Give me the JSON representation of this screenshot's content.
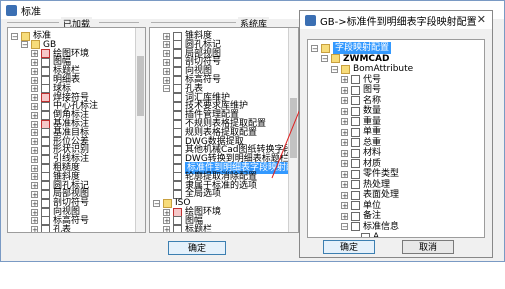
{
  "main_window": {
    "title": "标准",
    "loaded_label": "已加载",
    "system_label": "系统库",
    "ok_label": "确定"
  },
  "left_tree": [
    {
      "label": "标准",
      "indent": 0,
      "exp": "-",
      "icon": "folder"
    },
    {
      "label": "GB",
      "indent": 1,
      "exp": "-",
      "icon": "folder"
    },
    {
      "label": "绘图环境",
      "indent": 2,
      "exp": "+",
      "icon": "red"
    },
    {
      "label": "图幅",
      "indent": 2,
      "exp": "+",
      "icon": "doc"
    },
    {
      "label": "标题栏",
      "indent": 2,
      "exp": "+",
      "icon": "doc"
    },
    {
      "label": "明细表",
      "indent": 2,
      "exp": "+",
      "icon": "doc"
    },
    {
      "label": "球标",
      "indent": 2,
      "exp": "+",
      "icon": "doc"
    },
    {
      "label": "焊接符号",
      "indent": 2,
      "exp": "+",
      "icon": "red"
    },
    {
      "label": "中心孔标注",
      "indent": 2,
      "exp": "+",
      "icon": "doc"
    },
    {
      "label": "倒角标注",
      "indent": 2,
      "exp": "+",
      "icon": "doc"
    },
    {
      "label": "基准标注",
      "indent": 2,
      "exp": "+",
      "icon": "red"
    },
    {
      "label": "基准目标",
      "indent": 2,
      "exp": "+",
      "icon": "doc"
    },
    {
      "label": "形位公差",
      "indent": 2,
      "exp": "+",
      "icon": "doc"
    },
    {
      "label": "形状识别",
      "indent": 2,
      "exp": "+",
      "icon": "doc"
    },
    {
      "label": "引线标注",
      "indent": 2,
      "exp": "+",
      "icon": "doc"
    },
    {
      "label": "粗糙度",
      "indent": 2,
      "exp": "+",
      "icon": "doc"
    },
    {
      "label": "锥斜度",
      "indent": 2,
      "exp": "+",
      "icon": "doc"
    },
    {
      "label": "圆孔标记",
      "indent": 2,
      "exp": "+",
      "icon": "doc"
    },
    {
      "label": "局部视图",
      "indent": 2,
      "exp": "+",
      "icon": "doc"
    },
    {
      "label": "剖切符号",
      "indent": 2,
      "exp": "+",
      "icon": "doc"
    },
    {
      "label": "向视图",
      "indent": 2,
      "exp": "+",
      "icon": "doc"
    },
    {
      "label": "标高符号",
      "indent": 2,
      "exp": "+",
      "icon": "doc"
    },
    {
      "label": "孔表",
      "indent": 2,
      "exp": "+",
      "icon": "doc"
    }
  ],
  "middle_tree": [
    {
      "label": "锥斜度",
      "indent": 1,
      "exp": "+",
      "icon": "doc"
    },
    {
      "label": "圆孔标记",
      "indent": 1,
      "exp": "+",
      "icon": "doc"
    },
    {
      "label": "局部视图",
      "indent": 1,
      "exp": "+",
      "icon": "doc"
    },
    {
      "label": "剖切符号",
      "indent": 1,
      "exp": "+",
      "icon": "doc"
    },
    {
      "label": "向视图",
      "indent": 1,
      "exp": "+",
      "icon": "doc"
    },
    {
      "label": "标高符号",
      "indent": 1,
      "exp": "+",
      "icon": "doc"
    },
    {
      "label": "孔表",
      "indent": 1,
      "exp": "-",
      "icon": "doc"
    },
    {
      "label": "词汇库维护",
      "indent": 1,
      "exp": "",
      "icon": "doc"
    },
    {
      "label": "技术要求库维护",
      "indent": 1,
      "exp": "",
      "icon": "doc"
    },
    {
      "label": "插件管理配置",
      "indent": 1,
      "exp": "",
      "icon": "doc"
    },
    {
      "label": "不规则表格提取配置",
      "indent": 1,
      "exp": "",
      "icon": "doc"
    },
    {
      "label": "规则表格提取配置",
      "indent": 1,
      "exp": "",
      "icon": "doc"
    },
    {
      "label": "DWG数据提取",
      "indent": 1,
      "exp": "",
      "icon": "doc"
    },
    {
      "label": "其他机械Cad图纸转换字段映射",
      "indent": 1,
      "exp": "",
      "icon": "doc"
    },
    {
      "label": "DWG转换到明细表标题栏字段映射",
      "indent": 1,
      "exp": "",
      "icon": "doc"
    },
    {
      "label": "标准件到明细表字段映射配置",
      "indent": 1,
      "exp": "",
      "icon": "doc",
      "selected": true
    },
    {
      "label": "轮廓提取消除配置",
      "indent": 1,
      "exp": "",
      "icon": "doc"
    },
    {
      "label": "隶属于标准的选项",
      "indent": 1,
      "exp": "",
      "icon": "doc"
    },
    {
      "label": "全局选项",
      "indent": 1,
      "exp": "",
      "icon": "doc"
    },
    {
      "label": "ISO",
      "indent": 0,
      "exp": "-",
      "icon": "folder"
    },
    {
      "label": "绘图环境",
      "indent": 1,
      "exp": "+",
      "icon": "red"
    },
    {
      "label": "图幅",
      "indent": 1,
      "exp": "+",
      "icon": "doc"
    },
    {
      "label": "标题栏",
      "indent": 1,
      "exp": "+",
      "icon": "doc"
    }
  ],
  "dialog": {
    "title": "GB->标准件到明细表字段映射配置",
    "ok_label": "确定",
    "cancel_label": "取消",
    "tree": [
      {
        "label": "字段映射配置",
        "indent": 0,
        "exp": "-",
        "icon": "folder",
        "selected": true
      },
      {
        "label": "ZWMCAD",
        "indent": 1,
        "exp": "-",
        "icon": "folder",
        "bold": true
      },
      {
        "label": "BomAttribute",
        "indent": 2,
        "exp": "-",
        "icon": "folder"
      },
      {
        "label": "代号",
        "indent": 3,
        "exp": "+",
        "icon": "doc"
      },
      {
        "label": "图号",
        "indent": 3,
        "exp": "+",
        "icon": "doc"
      },
      {
        "label": "名称",
        "indent": 3,
        "exp": "+",
        "icon": "doc"
      },
      {
        "label": "数量",
        "indent": 3,
        "exp": "+",
        "icon": "doc"
      },
      {
        "label": "重量",
        "indent": 3,
        "exp": "+",
        "icon": "doc"
      },
      {
        "label": "单重",
        "indent": 3,
        "exp": "+",
        "icon": "doc"
      },
      {
        "label": "总重",
        "indent": 3,
        "exp": "+",
        "icon": "doc"
      },
      {
        "label": "材料",
        "indent": 3,
        "exp": "+",
        "icon": "doc"
      },
      {
        "label": "材质",
        "indent": 3,
        "exp": "+",
        "icon": "doc"
      },
      {
        "label": "零件类型",
        "indent": 3,
        "exp": "+",
        "icon": "doc"
      },
      {
        "label": "热处理",
        "indent": 3,
        "exp": "+",
        "icon": "doc"
      },
      {
        "label": "表面处理",
        "indent": 3,
        "exp": "+",
        "icon": "doc"
      },
      {
        "label": "单位",
        "indent": 3,
        "exp": "+",
        "icon": "doc"
      },
      {
        "label": "备注",
        "indent": 3,
        "exp": "+",
        "icon": "doc"
      },
      {
        "label": "标准信息",
        "indent": 3,
        "exp": "-",
        "icon": "doc"
      },
      {
        "label": "A",
        "indent": 4,
        "exp": "",
        "icon": "doc"
      }
    ]
  },
  "colors": {
    "selection": "#3399ff",
    "annotation": "#e02020"
  }
}
